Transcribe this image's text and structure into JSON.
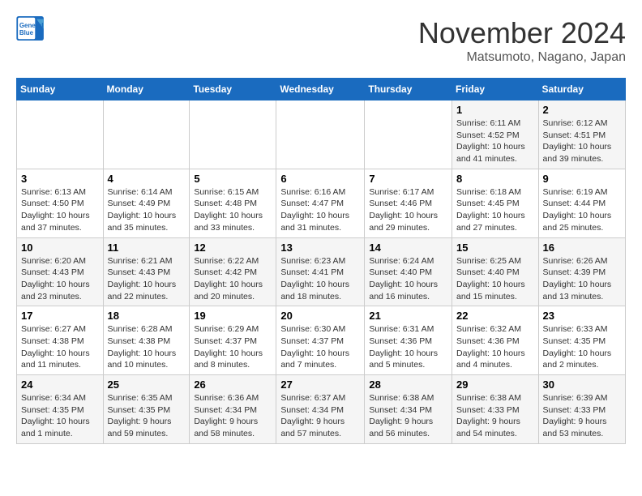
{
  "logo": {
    "line1": "General",
    "line2": "Blue"
  },
  "title": "November 2024",
  "location": "Matsumoto, Nagano, Japan",
  "weekdays": [
    "Sunday",
    "Monday",
    "Tuesday",
    "Wednesday",
    "Thursday",
    "Friday",
    "Saturday"
  ],
  "weeks": [
    [
      {
        "day": "",
        "info": ""
      },
      {
        "day": "",
        "info": ""
      },
      {
        "day": "",
        "info": ""
      },
      {
        "day": "",
        "info": ""
      },
      {
        "day": "",
        "info": ""
      },
      {
        "day": "1",
        "info": "Sunrise: 6:11 AM\nSunset: 4:52 PM\nDaylight: 10 hours and 41 minutes."
      },
      {
        "day": "2",
        "info": "Sunrise: 6:12 AM\nSunset: 4:51 PM\nDaylight: 10 hours and 39 minutes."
      }
    ],
    [
      {
        "day": "3",
        "info": "Sunrise: 6:13 AM\nSunset: 4:50 PM\nDaylight: 10 hours and 37 minutes."
      },
      {
        "day": "4",
        "info": "Sunrise: 6:14 AM\nSunset: 4:49 PM\nDaylight: 10 hours and 35 minutes."
      },
      {
        "day": "5",
        "info": "Sunrise: 6:15 AM\nSunset: 4:48 PM\nDaylight: 10 hours and 33 minutes."
      },
      {
        "day": "6",
        "info": "Sunrise: 6:16 AM\nSunset: 4:47 PM\nDaylight: 10 hours and 31 minutes."
      },
      {
        "day": "7",
        "info": "Sunrise: 6:17 AM\nSunset: 4:46 PM\nDaylight: 10 hours and 29 minutes."
      },
      {
        "day": "8",
        "info": "Sunrise: 6:18 AM\nSunset: 4:45 PM\nDaylight: 10 hours and 27 minutes."
      },
      {
        "day": "9",
        "info": "Sunrise: 6:19 AM\nSunset: 4:44 PM\nDaylight: 10 hours and 25 minutes."
      }
    ],
    [
      {
        "day": "10",
        "info": "Sunrise: 6:20 AM\nSunset: 4:43 PM\nDaylight: 10 hours and 23 minutes."
      },
      {
        "day": "11",
        "info": "Sunrise: 6:21 AM\nSunset: 4:43 PM\nDaylight: 10 hours and 22 minutes."
      },
      {
        "day": "12",
        "info": "Sunrise: 6:22 AM\nSunset: 4:42 PM\nDaylight: 10 hours and 20 minutes."
      },
      {
        "day": "13",
        "info": "Sunrise: 6:23 AM\nSunset: 4:41 PM\nDaylight: 10 hours and 18 minutes."
      },
      {
        "day": "14",
        "info": "Sunrise: 6:24 AM\nSunset: 4:40 PM\nDaylight: 10 hours and 16 minutes."
      },
      {
        "day": "15",
        "info": "Sunrise: 6:25 AM\nSunset: 4:40 PM\nDaylight: 10 hours and 15 minutes."
      },
      {
        "day": "16",
        "info": "Sunrise: 6:26 AM\nSunset: 4:39 PM\nDaylight: 10 hours and 13 minutes."
      }
    ],
    [
      {
        "day": "17",
        "info": "Sunrise: 6:27 AM\nSunset: 4:38 PM\nDaylight: 10 hours and 11 minutes."
      },
      {
        "day": "18",
        "info": "Sunrise: 6:28 AM\nSunset: 4:38 PM\nDaylight: 10 hours and 10 minutes."
      },
      {
        "day": "19",
        "info": "Sunrise: 6:29 AM\nSunset: 4:37 PM\nDaylight: 10 hours and 8 minutes."
      },
      {
        "day": "20",
        "info": "Sunrise: 6:30 AM\nSunset: 4:37 PM\nDaylight: 10 hours and 7 minutes."
      },
      {
        "day": "21",
        "info": "Sunrise: 6:31 AM\nSunset: 4:36 PM\nDaylight: 10 hours and 5 minutes."
      },
      {
        "day": "22",
        "info": "Sunrise: 6:32 AM\nSunset: 4:36 PM\nDaylight: 10 hours and 4 minutes."
      },
      {
        "day": "23",
        "info": "Sunrise: 6:33 AM\nSunset: 4:35 PM\nDaylight: 10 hours and 2 minutes."
      }
    ],
    [
      {
        "day": "24",
        "info": "Sunrise: 6:34 AM\nSunset: 4:35 PM\nDaylight: 10 hours and 1 minute."
      },
      {
        "day": "25",
        "info": "Sunrise: 6:35 AM\nSunset: 4:35 PM\nDaylight: 9 hours and 59 minutes."
      },
      {
        "day": "26",
        "info": "Sunrise: 6:36 AM\nSunset: 4:34 PM\nDaylight: 9 hours and 58 minutes."
      },
      {
        "day": "27",
        "info": "Sunrise: 6:37 AM\nSunset: 4:34 PM\nDaylight: 9 hours and 57 minutes."
      },
      {
        "day": "28",
        "info": "Sunrise: 6:38 AM\nSunset: 4:34 PM\nDaylight: 9 hours and 56 minutes."
      },
      {
        "day": "29",
        "info": "Sunrise: 6:38 AM\nSunset: 4:33 PM\nDaylight: 9 hours and 54 minutes."
      },
      {
        "day": "30",
        "info": "Sunrise: 6:39 AM\nSunset: 4:33 PM\nDaylight: 9 hours and 53 minutes."
      }
    ]
  ]
}
